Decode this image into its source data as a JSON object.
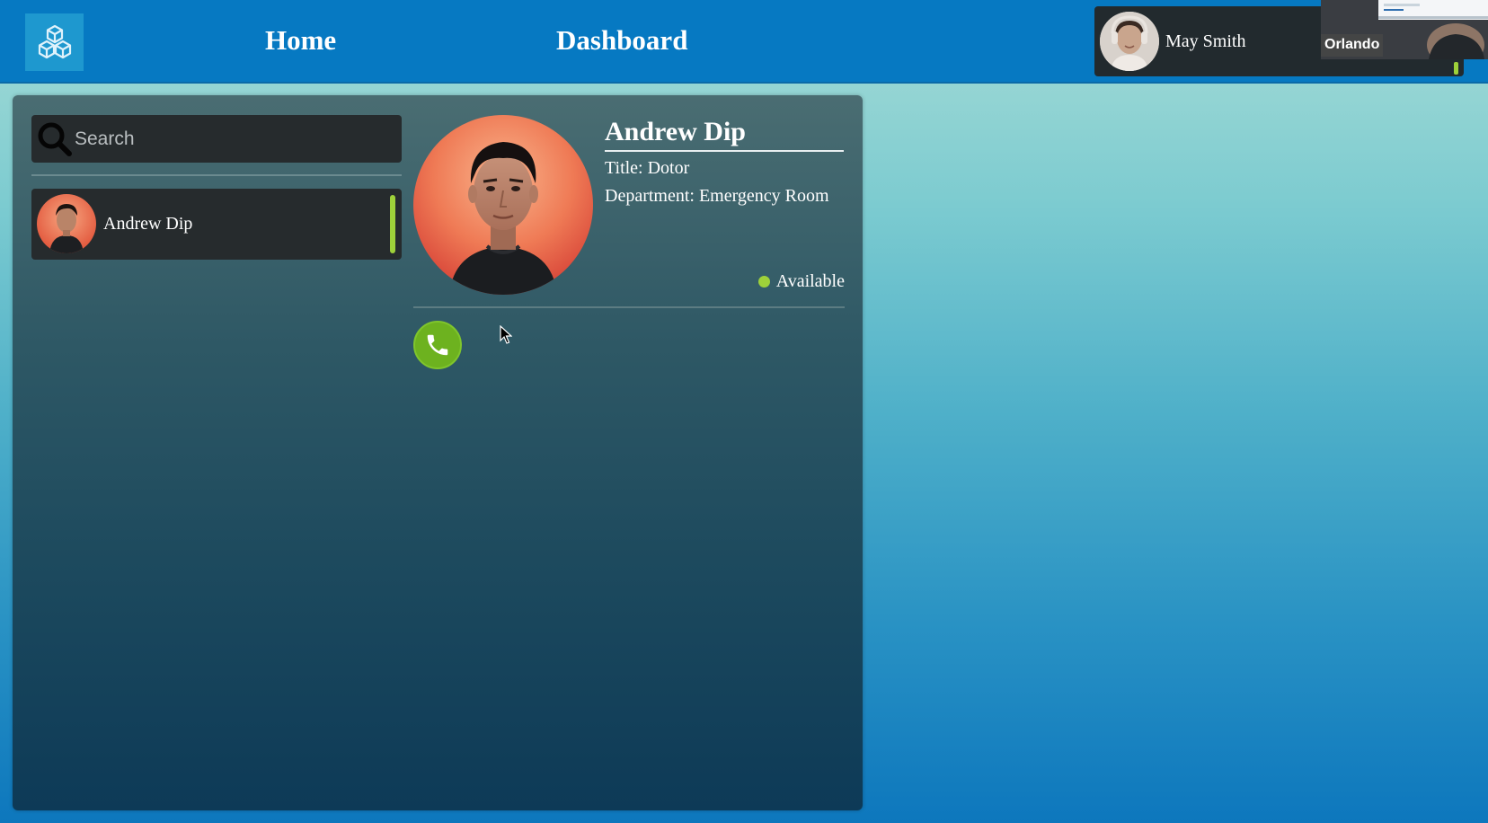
{
  "header": {
    "logo_icon": "cubes-logo-icon",
    "nav": [
      {
        "label": "Home"
      },
      {
        "label": "Dashboard"
      }
    ],
    "user": {
      "name": "May Smith",
      "status_color": "#9ed13a"
    },
    "video_thumbnail": {
      "label": "Orlando"
    }
  },
  "sidebar": {
    "search": {
      "placeholder": "Search",
      "value": ""
    },
    "contacts": [
      {
        "name": "Andrew Dip",
        "status_color": "#9ed13a"
      }
    ]
  },
  "profile": {
    "name": "Andrew Dip",
    "title_line": "Title: Dotor",
    "department_line": "Department: Emergency Room",
    "status": "Available",
    "status_color": "#9ed13a",
    "call_icon": "phone-icon"
  },
  "colors": {
    "topbar": "#0679c2",
    "accent_green": "#6db21f"
  }
}
